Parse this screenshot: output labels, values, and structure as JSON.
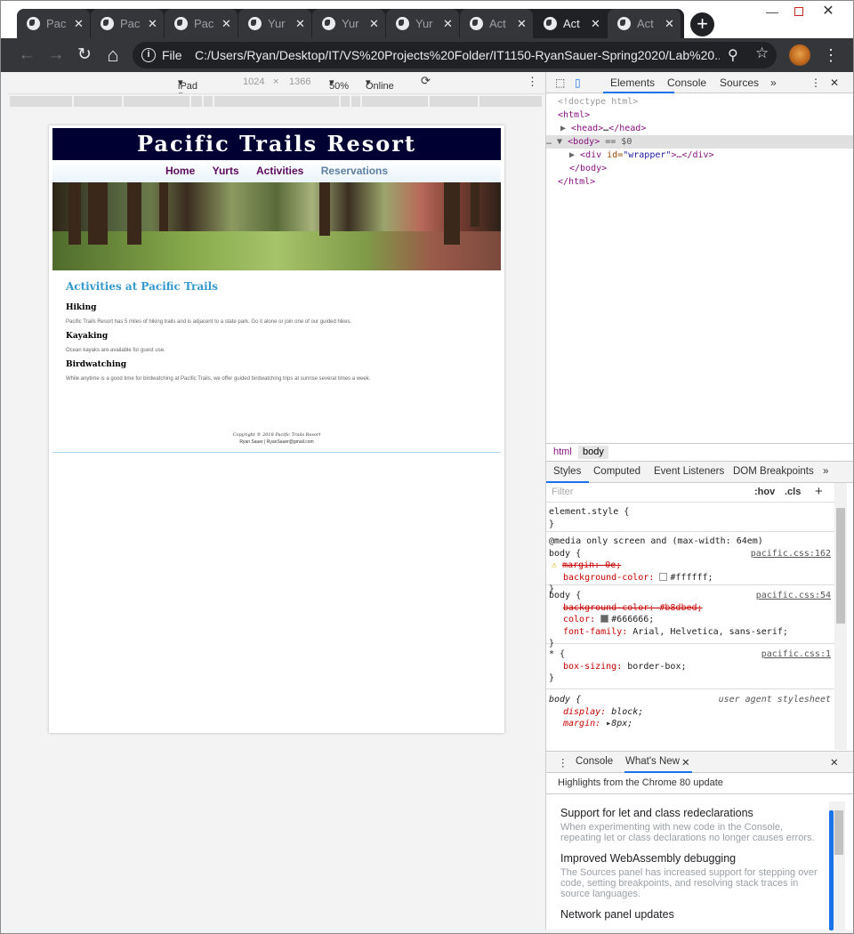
{
  "window": {
    "tabs": [
      {
        "title": "Pac",
        "active": false
      },
      {
        "title": "Pac",
        "active": false
      },
      {
        "title": "Pac",
        "active": false
      },
      {
        "title": "Yur",
        "active": false
      },
      {
        "title": "Yur",
        "active": false
      },
      {
        "title": "Yur",
        "active": false
      },
      {
        "title": "Act",
        "active": false
      },
      {
        "title": "Act",
        "active": true
      },
      {
        "title": "Act",
        "active": false
      }
    ],
    "new_tab": "+",
    "minimize": "—",
    "close": "✕"
  },
  "toolbar": {
    "back": "←",
    "forward": "→",
    "reload": "↻",
    "home": "⌂",
    "info": "i",
    "scheme": "File",
    "url": "C:/Users/Ryan/Desktop/IT/VS%20Projects%20Folder/IT1150-RyanSauer-Spring2020/Lab%20...",
    "zoom_icon": "⚲",
    "star_icon": "☆",
    "menu": "⋮"
  },
  "device_toolbar": {
    "device": "iPad Pro",
    "width": "1024",
    "times": "×",
    "height": "1366",
    "zoom": "50%",
    "network": "Online",
    "rotate": "⟳",
    "menu": "⋮"
  },
  "site": {
    "header": "Pacific Trails Resort",
    "nav": [
      "Home",
      "Yurts",
      "Activities",
      "Reservations"
    ],
    "heading": "Activities at Pacific Trails",
    "sections": [
      {
        "title": "Hiking",
        "text": "Pacific Trails Resort has 5 miles of hiking trails and is adjacent to a state park. Go it alone or join one of our guided hikes."
      },
      {
        "title": "Kayaking",
        "text": "Ocean kayaks are available for guest use."
      },
      {
        "title": "Birdwatching",
        "text": "While anytime is a good time for birdwatching at Pacific Trails, we offer guided birdwatching trips at sunrise several times a week."
      }
    ],
    "footer_copyright": "Copyright © 2018 Pacific Trails Resort",
    "footer_email": "Ryan Sauer | RyanSauer@gmail.com"
  },
  "devtools": {
    "tabs": [
      "Elements",
      "Console",
      "Sources"
    ],
    "more": "»",
    "menu": "⋮",
    "close": "✕",
    "dom": {
      "doctype": "<!doctype html>",
      "html_open": "<html>",
      "head": "<head>",
      "head_ellipsis": "…",
      "head_close": "</head>",
      "body_open": "<body>",
      "eq": "== $0",
      "div_open": "<div ",
      "div_attr": "id=",
      "div_val": "\"wrapper\"",
      "div_rest": ">…</div>",
      "body_close": "</body>",
      "html_close": "</html>"
    },
    "breadcrumbs": [
      "html",
      "body"
    ],
    "styles_tabs": [
      "Styles",
      "Computed",
      "Event Listeners",
      "DOM Breakpoints"
    ],
    "filter_placeholder": "Filter",
    "hov": ":hov",
    "cls": ".cls",
    "plus": "+",
    "rules": {
      "element_style": "element.style {",
      "close": "}",
      "media": "@media only screen and (max-width: 64em)",
      "r1_selector": "body {",
      "r1_src": "pacific.css:162",
      "r1_p1": "margin: 0e;",
      "r1_p2_name": "background-color:",
      "r1_p2_val": "#ffffff;",
      "r2_selector": "body {",
      "r2_src": "pacific.css:54",
      "r2_p1": "background-color: #b8dbed;",
      "r2_p2_name": "color:",
      "r2_p2_val": "#666666;",
      "r2_p3_name": "font-family:",
      "r2_p3_val": "Arial, Helvetica, sans-serif;",
      "r3_selector": "* {",
      "r3_src": "pacific.css:1",
      "r3_p1_name": "box-sizing:",
      "r3_p1_val": "border-box;",
      "r4_selector": "body {",
      "r4_src": "user agent stylesheet",
      "r4_p1_name": "display:",
      "r4_p1_val": "block;",
      "r4_p2_name": "margin:",
      "r4_p2_val": "8px;"
    },
    "swatches": {
      "white": "#ffffff",
      "blue": "#b8dbed",
      "gray": "#666666"
    },
    "drawer": {
      "tabs": [
        "Console",
        "What's New"
      ],
      "highlights": "Highlights from the Chrome 80 update",
      "items": [
        {
          "title": "Support for let and class redeclarations",
          "text": "When experimenting with new code in the Console, repeating let or class declarations no longer causes errors."
        },
        {
          "title": "Improved WebAssembly debugging",
          "text": "The Sources panel has increased support for stepping over code, setting breakpoints, and resolving stack traces in source languages."
        },
        {
          "title": "Network panel updates",
          "text": ""
        }
      ]
    }
  }
}
